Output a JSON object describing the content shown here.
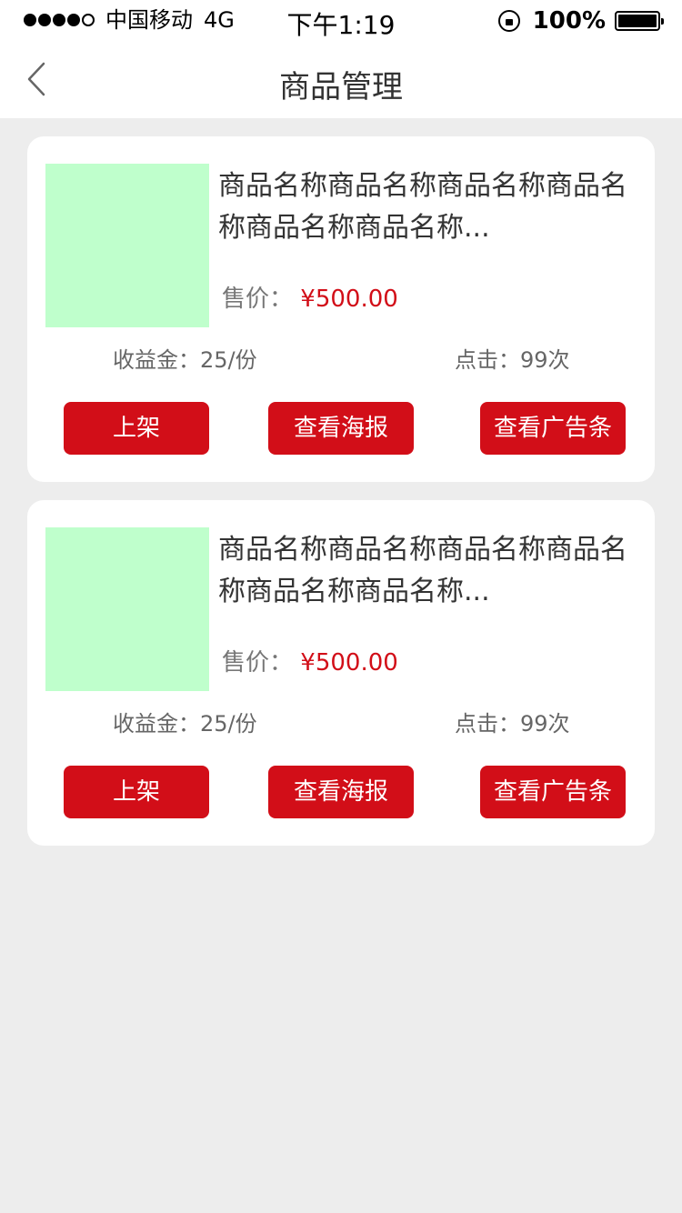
{
  "statusbar": {
    "carrier": "中国移动",
    "network": "4G",
    "time": "下午1:19",
    "battery": "100%"
  },
  "nav": {
    "title": "商品管理",
    "back_icon": "chevron-left-icon"
  },
  "products": [
    {
      "name": "商品名称商品名称商品名称商品名称商品名称商品名称...",
      "price_label": "售价：",
      "price": "¥500.00",
      "earnings": "收益金：25/份",
      "clicks": "点击：99次",
      "buttons": {
        "shelf": "上架",
        "poster": "查看海报",
        "banner": "查看广告条"
      }
    },
    {
      "name": "商品名称商品名称商品名称商品名称商品名称商品名称...",
      "price_label": "售价：",
      "price": "¥500.00",
      "earnings": "收益金：25/份",
      "clicks": "点击：99次",
      "buttons": {
        "shelf": "上架",
        "poster": "查看海报",
        "banner": "查看广告条"
      }
    }
  ],
  "colors": {
    "accent": "#d20e18",
    "background": "#ededed",
    "thumbnail": "#bfffcc"
  }
}
